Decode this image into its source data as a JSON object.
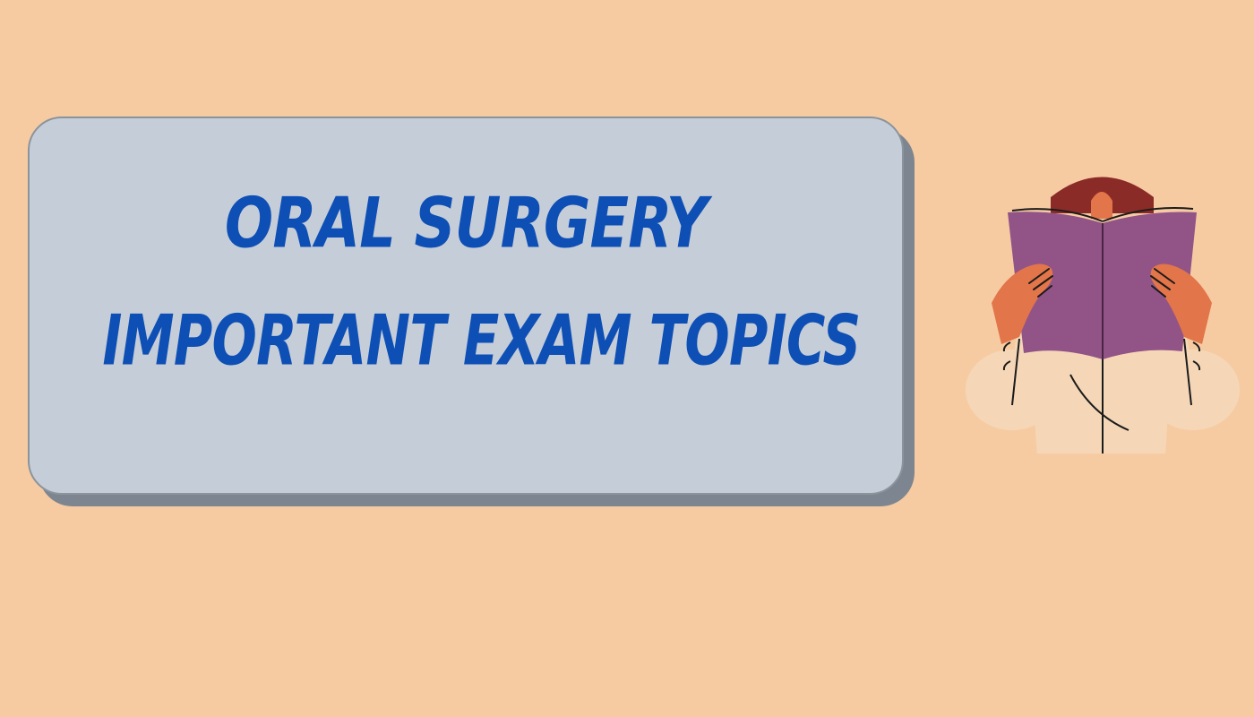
{
  "title": {
    "line_1": "ORAL SURGERY",
    "line_2": "IMPORTANT EXAM TOPICS"
  },
  "illustration": {
    "icon": "person-reading-book-icon"
  },
  "colors": {
    "background": "#f6cba2",
    "card": "#c5cdd8",
    "card_shadow": "#7d8690",
    "title_text": "#0d4fb5",
    "book": "#925487",
    "hair": "#8a2b27",
    "skin": "#e27549",
    "shirt": "#f5d7b8"
  }
}
